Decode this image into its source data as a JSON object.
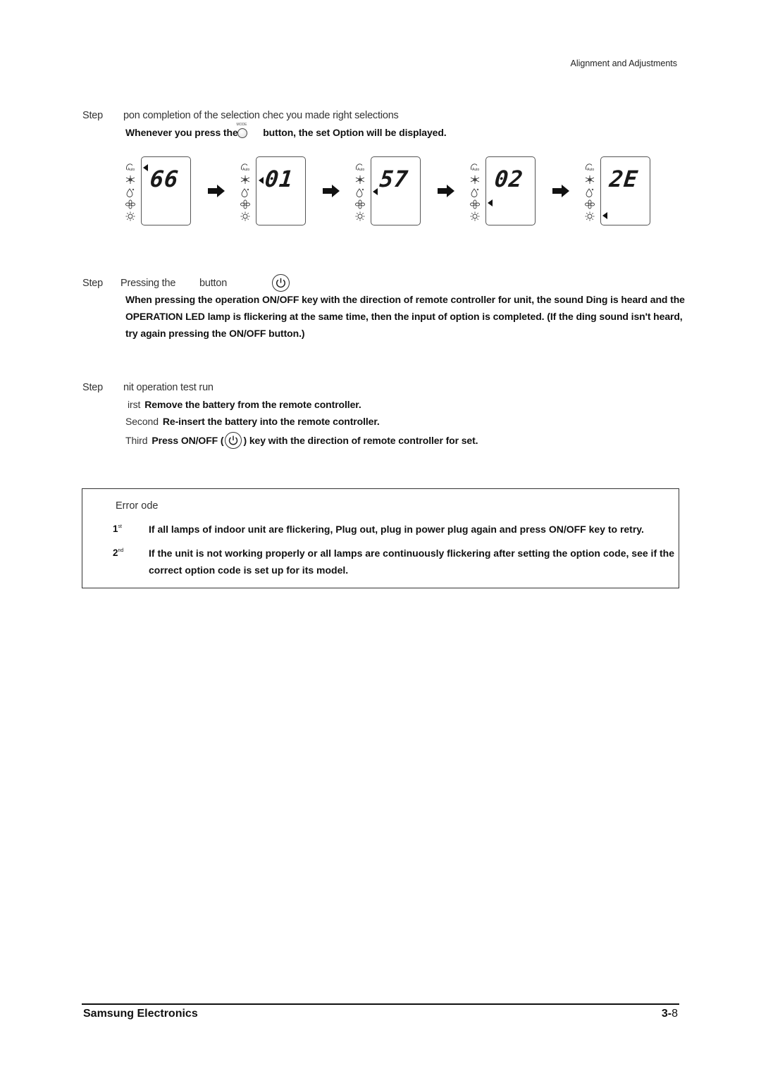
{
  "header": {
    "section_title": "Alignment and Adjustments"
  },
  "step_a": {
    "label": "Step",
    "title": "pon completion of the selection  chec  you made right selections",
    "instruction_before": "Whenever you press the",
    "button_name": "MODE",
    "instruction_after": "button, the set Option will be displayed."
  },
  "display_sequence": [
    {
      "digits": "66",
      "pointer": "auto"
    },
    {
      "digits": "01",
      "pointer": "cool"
    },
    {
      "digits": "57",
      "pointer": "dry"
    },
    {
      "digits": "02",
      "pointer": "fan"
    },
    {
      "digits": "2E",
      "pointer": "heat"
    }
  ],
  "mode_icons": [
    {
      "name": "auto-mode-icon",
      "label": "Auto"
    },
    {
      "name": "cool-mode-icon",
      "label": ""
    },
    {
      "name": "dry-mode-icon",
      "label": ""
    },
    {
      "name": "fan-mode-icon",
      "label": ""
    },
    {
      "name": "heat-mode-icon",
      "label": ""
    }
  ],
  "step_b": {
    "label": "Step",
    "title_before": "Pressing the",
    "title_after": "button",
    "body": [
      "When pressing the operation ON/OFF key with the direction of remote controller for unit, the sound  Ding  is heard and the",
      "OPERATION LED lamp is flickering at the same time, then the input of option is completed. (If the  ding  sound isn't heard,",
      "try again pressing the ON/OFF button.)"
    ]
  },
  "step_c": {
    "label": "Step",
    "title": "nit operation test run",
    "items": [
      {
        "ordinal": "irst",
        "text": "Remove the battery from the remote controller."
      },
      {
        "ordinal": "Second",
        "text": "Re-insert the battery into the remote controller."
      },
      {
        "ordinal": "Third",
        "text_before": "Press ON/OFF (",
        "text_after": ") key with the direction of remote controller for set."
      }
    ]
  },
  "error_code": {
    "title": "Error  ode",
    "items": [
      {
        "num": "1",
        "suffix": "st",
        "lines": [
          "If all lamps of indoor unit are flickering, Plug out, plug in power plug again and press ON/OFF key to retry."
        ]
      },
      {
        "num": "2",
        "suffix": "nd",
        "lines": [
          "If the unit is not working properly or all lamps are continuously flickering after setting the option code, see if the",
          "correct option code is set up for its model."
        ]
      }
    ]
  },
  "footer": {
    "company": "Samsung Electronics",
    "page_chapter": "3-",
    "page_num": "8"
  }
}
